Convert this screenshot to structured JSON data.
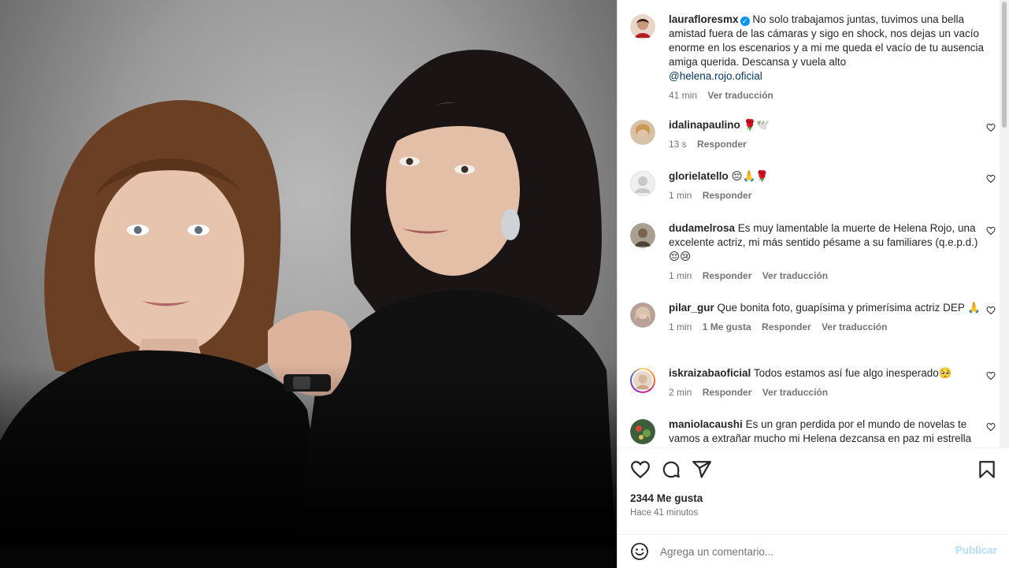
{
  "post": {
    "author": "laurafloresmx",
    "caption": "No solo trabajamos juntas, tuvimos una bella amistad fuera de las cámaras y sigo en shock, nos dejas un vacío enorme en los escenarios y a mi me queda el vacío de tu ausencia amiga querida. Descansa y vuela alto",
    "mention": "@helena.rojo.oficial",
    "caption_time": "41 min",
    "caption_translate": "Ver traducción",
    "likes": "2344 Me gusta",
    "posted_ago": "Hace 41 minutos"
  },
  "comments": [
    {
      "user": "idalinapaulino",
      "text": "🌹🕊️",
      "time": "13 s",
      "likes": "",
      "reply": "Responder",
      "translate": ""
    },
    {
      "user": "glorielatello",
      "text": "😔🙏🌹",
      "time": "1 min",
      "likes": "",
      "reply": "Responder",
      "translate": ""
    },
    {
      "user": "dudamelrosa",
      "text": "Es muy lamentable la muerte de Helena Rojo, una excelente actriz, mi más sentido pésame a su familiares (q.e.p.d.) 😔😢",
      "time": "1 min",
      "likes": "",
      "reply": "Responder",
      "translate": "Ver traducción"
    },
    {
      "user": "pilar_gur",
      "text": "Que bonita foto, guapísima y primerísima actriz DEP 🙏",
      "time": "1 min",
      "likes": "1 Me gusta",
      "reply": "Responder",
      "translate": "Ver traducción"
    },
    {
      "user": "iskraizabaoficial",
      "text": "Todos estamos así fue algo inesperado🥺",
      "time": "2 min",
      "likes": "",
      "reply": "Responder",
      "translate": "Ver traducción"
    },
    {
      "user": "maniolacaushi",
      "text": "Es un gran perdida por el mundo de novelas te vamos a extrañar mucho mi Helena dezcansa en paz mi estrella",
      "time": "",
      "likes": "",
      "reply": "",
      "translate": ""
    }
  ],
  "add_comment": {
    "placeholder": "Agrega un comentario...",
    "publish": "Publicar"
  },
  "icons": {
    "like": "heart-icon",
    "comment": "comment-icon",
    "share": "share-icon",
    "save": "bookmark-icon",
    "emoji": "emoji-icon",
    "verified": "verified-badge-icon"
  },
  "colors": {
    "accent": "#0095f6",
    "publish_disabled": "#b2dffc",
    "muted": "#737373"
  }
}
